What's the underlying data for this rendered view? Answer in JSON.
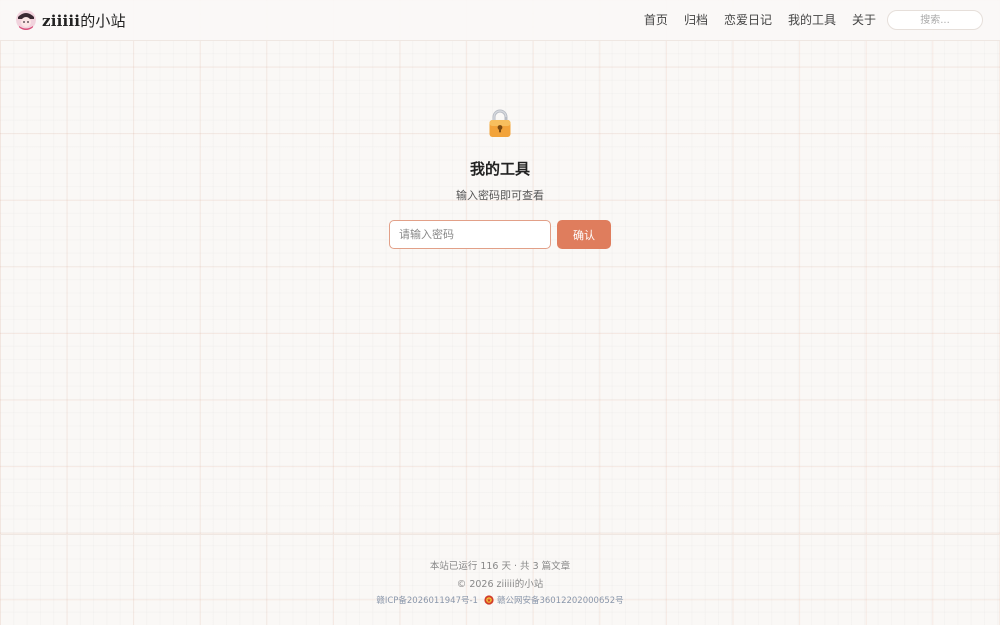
{
  "header": {
    "brand_bold": "ziiiii",
    "brand_suffix": "的小站",
    "nav": [
      "首页",
      "归档",
      "恋爱日记",
      "我的工具",
      "关于"
    ],
    "search_placeholder": "搜索..."
  },
  "main": {
    "icon": "lock-icon",
    "title": "我的工具",
    "subtitle": "输入密码即可查看",
    "password_placeholder": "请输入密码",
    "confirm_label": "确认"
  },
  "footer": {
    "stats": "本站已运行 116 天 · 共 3 篇文章",
    "copyright": "© 2026 ziiiii的小站",
    "icp": "赣ICP备2026011947号-1",
    "police_icon": "police-badge-icon",
    "police": "赣公网安备36012202000652号"
  },
  "colors": {
    "accent": "#df7d5d",
    "input_border": "#e2a088",
    "link_muted": "#8a97ab"
  }
}
